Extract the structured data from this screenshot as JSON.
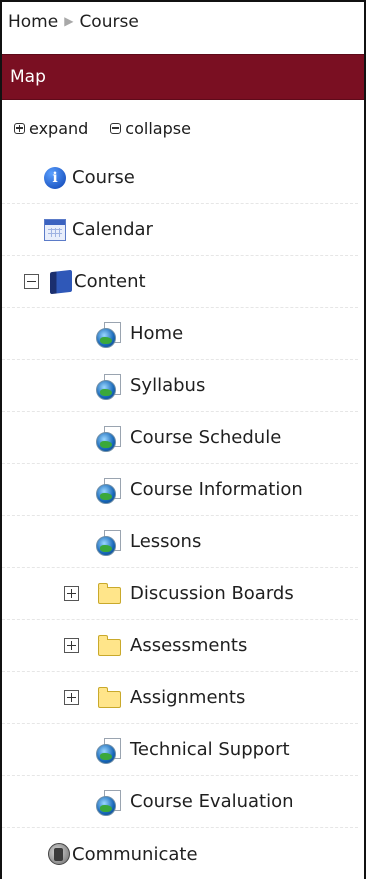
{
  "breadcrumb": {
    "home": "Home",
    "current": "Course"
  },
  "map": {
    "title": "Map",
    "expand_label": "expand",
    "collapse_label": "collapse"
  },
  "tree": {
    "course": "Course",
    "calendar": "Calendar",
    "content": "Content",
    "home": "Home",
    "syllabus": "Syllabus",
    "course_schedule": "Course Schedule",
    "course_information": "Course Information",
    "lessons": "Lessons",
    "discussion_boards": "Discussion Boards",
    "assessments": "Assessments",
    "assignments": "Assignments",
    "technical_support": "Technical Support",
    "course_evaluation": "Course Evaluation",
    "communicate": "Communicate"
  },
  "colors": {
    "map_header_bg": "#7a0f22",
    "map_header_text": "#ffffff"
  }
}
